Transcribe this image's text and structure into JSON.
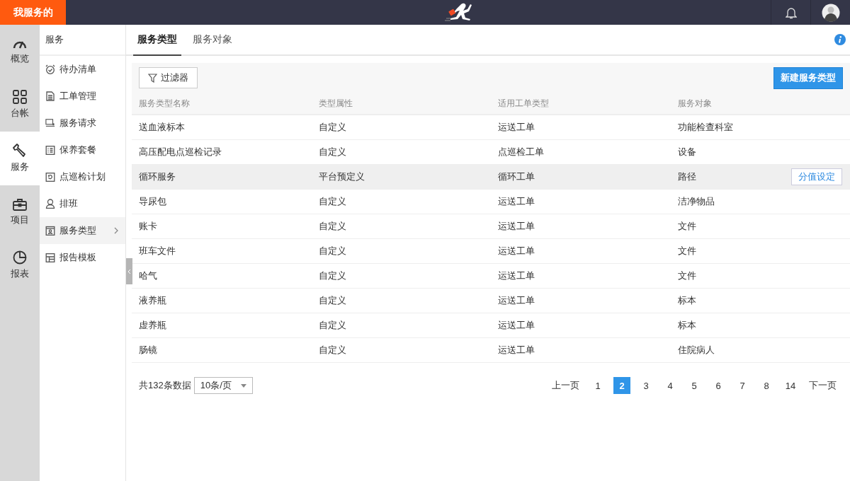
{
  "brand": "我服务的",
  "rail": [
    {
      "label": "概览",
      "selected": false
    },
    {
      "label": "台帐",
      "selected": false
    },
    {
      "label": "服务",
      "selected": true
    },
    {
      "label": "项目",
      "selected": false
    },
    {
      "label": "报表",
      "selected": false
    }
  ],
  "submenu": {
    "title": "服务",
    "items": [
      {
        "label": "待办清单",
        "selected": false
      },
      {
        "label": "工单管理",
        "selected": false
      },
      {
        "label": "服务请求",
        "selected": false
      },
      {
        "label": "保养套餐",
        "selected": false
      },
      {
        "label": "点巡检计划",
        "selected": false
      },
      {
        "label": "排班",
        "selected": false
      },
      {
        "label": "服务类型",
        "selected": true
      },
      {
        "label": "报告模板",
        "selected": false
      }
    ]
  },
  "tabs": [
    {
      "label": "服务类型",
      "selected": true
    },
    {
      "label": "服务对象",
      "selected": false
    }
  ],
  "toolbar": {
    "filter_button": "过滤器",
    "new_button": "新建服务类型"
  },
  "table": {
    "columns": [
      "服务类型名称",
      "类型属性",
      "适用工单类型",
      "服务对象"
    ],
    "rows": [
      {
        "cells": [
          "送血液标本",
          "自定义",
          "运送工单",
          "功能检查科室"
        ],
        "highlighted": false
      },
      {
        "cells": [
          "高压配电点巡检记录",
          "自定义",
          "点巡检工单",
          "设备"
        ],
        "highlighted": false
      },
      {
        "cells": [
          "循环服务",
          "平台预定义",
          "循环工单",
          "路径"
        ],
        "highlighted": true,
        "action": "分值设定"
      },
      {
        "cells": [
          "导尿包",
          "自定义",
          "运送工单",
          "洁净物品"
        ],
        "highlighted": false
      },
      {
        "cells": [
          "账卡",
          "自定义",
          "运送工单",
          "文件"
        ],
        "highlighted": false
      },
      {
        "cells": [
          "班车文件",
          "自定义",
          "运送工单",
          "文件"
        ],
        "highlighted": false
      },
      {
        "cells": [
          "哈气",
          "自定义",
          "运送工单",
          "文件"
        ],
        "highlighted": false
      },
      {
        "cells": [
          "液养瓶",
          "自定义",
          "运送工单",
          "标本"
        ],
        "highlighted": false
      },
      {
        "cells": [
          "虚养瓶",
          "自定义",
          "运送工单",
          "标本"
        ],
        "highlighted": false
      },
      {
        "cells": [
          "肠镜",
          "自定义",
          "运送工单",
          "住院病人"
        ],
        "highlighted": false
      }
    ]
  },
  "pagination": {
    "total": "共132条数据",
    "page_size": "10条/页",
    "prev": "上一页",
    "next": "下一页",
    "pages": [
      {
        "label": "1",
        "selected": false
      },
      {
        "label": "2",
        "selected": true
      },
      {
        "label": "3",
        "selected": false
      },
      {
        "label": "4",
        "selected": false
      },
      {
        "label": "5",
        "selected": false
      },
      {
        "label": "6",
        "selected": false
      },
      {
        "label": "7",
        "selected": false
      },
      {
        "label": "8",
        "selected": false
      },
      {
        "label": "14",
        "selected": false
      }
    ]
  }
}
